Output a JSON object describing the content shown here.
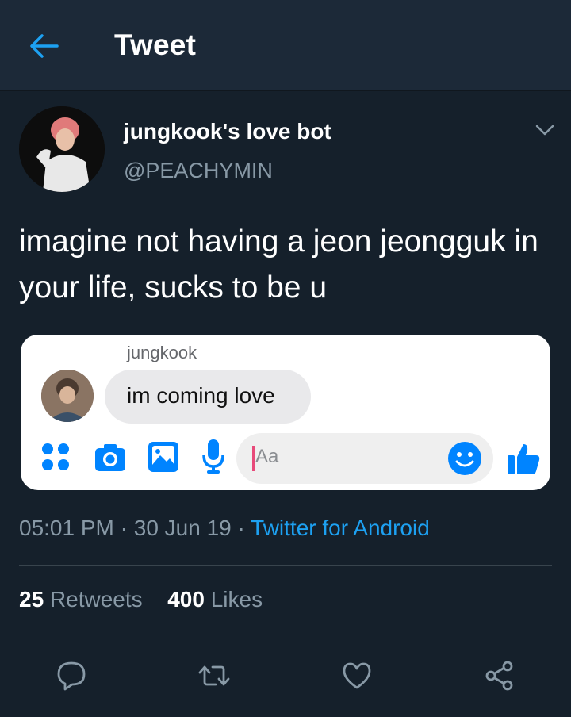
{
  "header": {
    "title": "Tweet",
    "back_icon": "arrow-left-icon"
  },
  "tweet": {
    "display_name": "jungkook's love bot",
    "handle": "@PEACHYMIN",
    "text": "imagine not having a jeon jeongguk in your life, sucks to be u",
    "time": "05:01 PM",
    "date": "30 Jun 19",
    "separator": "·",
    "source": "Twitter for Android",
    "retweets_count": "25",
    "retweets_label": "Retweets",
    "likes_count": "400",
    "likes_label": "Likes"
  },
  "embedded_chat": {
    "sender": "jungkook",
    "message": "im coming love",
    "input_placeholder": "Aa",
    "icons": [
      "apps-icon",
      "camera-icon",
      "image-icon",
      "microphone-icon",
      "emoji-icon",
      "thumbs-up-icon"
    ]
  },
  "actions": [
    "reply-icon",
    "retweet-icon",
    "like-icon",
    "share-icon"
  ],
  "colors": {
    "background": "#15202b",
    "header": "#1c2938",
    "accent": "#1da1f2",
    "muted": "#8899a6",
    "messenger_blue": "#0084ff"
  }
}
